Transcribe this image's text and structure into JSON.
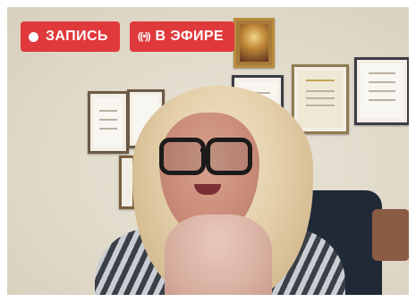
{
  "overlay": {
    "recording_label": "ЗАПИСЬ",
    "live_label": "В ЭФИРЕ",
    "live_icon_glyph": "((•))",
    "badge_color": "#e0393b"
  },
  "video": {
    "scene": "webcam-feed"
  }
}
